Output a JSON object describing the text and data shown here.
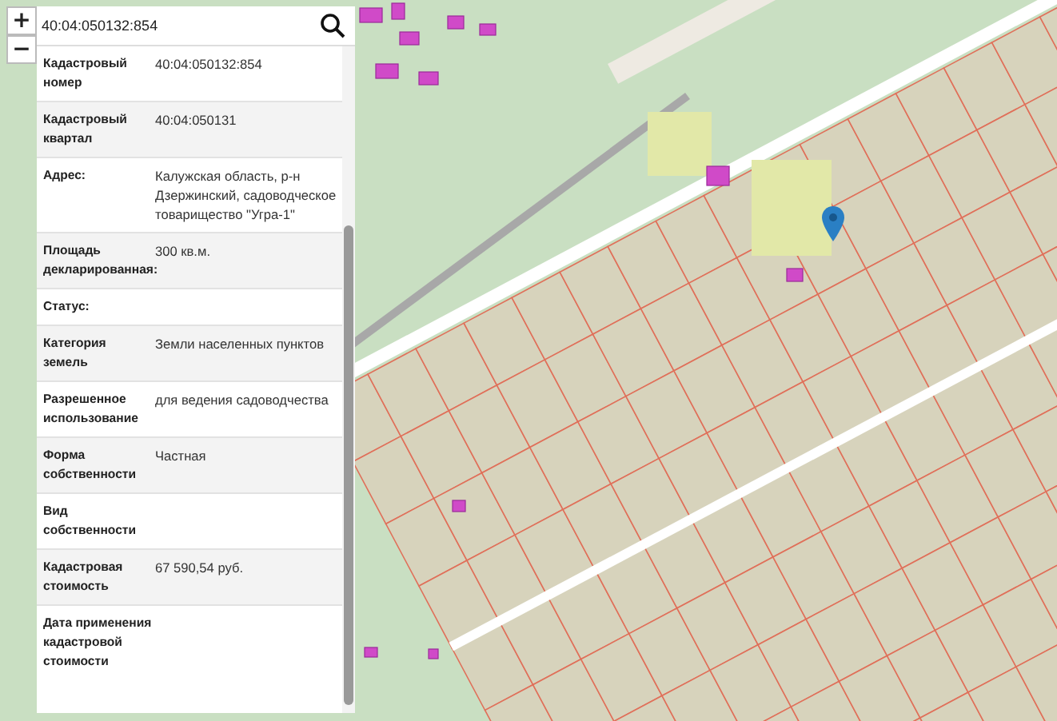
{
  "zoom_controls": [
    {
      "label": "+"
    },
    {
      "label": "−"
    }
  ],
  "search": {
    "value": "40:04:050132:854"
  },
  "info_rows": [
    {
      "label": "Кадастровый номер",
      "value": "40:04:050132:854"
    },
    {
      "label": "Кадастровый квартал",
      "value": "40:04:050131"
    },
    {
      "label": "Адрес:",
      "value": "Калужская область, р-н Дзержинский, садоводческое товарищество \"Угра-1\""
    },
    {
      "label": "Площадь декларированная:",
      "value": "300 кв.м."
    },
    {
      "label": "Статус:",
      "value": ""
    },
    {
      "label": "Категория земель",
      "value": "Земли населенных пунктов"
    },
    {
      "label": "Разрешенное использование",
      "value": "для ведения садоводчества"
    },
    {
      "label": "Форма собственности",
      "value": "Частная"
    },
    {
      "label": "Вид собственности",
      "value": ""
    },
    {
      "label": "Кадастровая стоимость",
      "value": "67 590,54 руб."
    },
    {
      "label": "Дата применения кадастровой стоимости",
      "value": ""
    }
  ]
}
